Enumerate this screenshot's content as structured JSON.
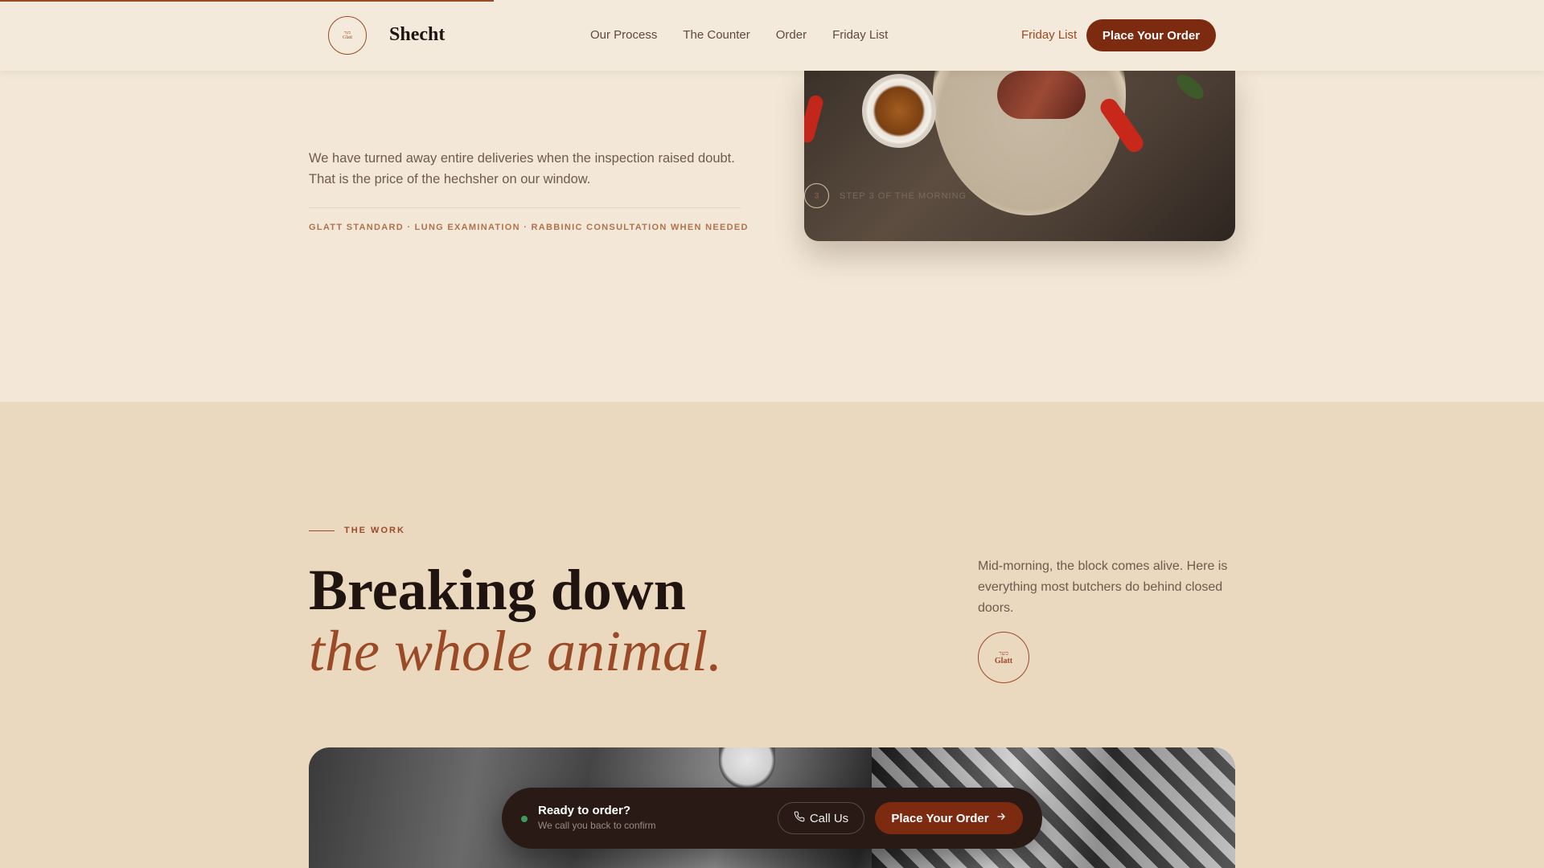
{
  "progress": {
    "fraction": 0.32,
    "color": "#9a4a26"
  },
  "header": {
    "logo": {
      "hebrew_text": "כשר",
      "latin_text": "Glatt"
    },
    "brand": "Shecht",
    "nav": [
      "Our Process",
      "The Counter",
      "Order",
      "Friday List"
    ],
    "secondary_link": "Friday List",
    "cta_label": "Place Your Order"
  },
  "process": {
    "body_lines": [
      "We have turned away entire deliveries when the inspection raised doubt.",
      "That is the price of the hechsher on our window."
    ],
    "tags": "GLATT STANDARD · LUNG EXAMINATION · RABBINIC CONSULTATION WHEN NEEDED",
    "step_number": "3",
    "step_label": "STEP 3 OF THE MORNING"
  },
  "work": {
    "eyebrow": "THE WORK",
    "headline": "Breaking down",
    "headline_accent": "the whole animal.",
    "side_text": "Mid-morning, the block comes alive. Here is everything most butchers do behind closed doors.",
    "seal": {
      "hebrew_text": "כשר",
      "latin_text": "Glatt"
    }
  },
  "order_bar": {
    "title": "Ready to order?",
    "subtitle": "We call you back to confirm",
    "call_label": "Call Us",
    "order_label": "Place Your Order",
    "status_color": "#3e9a5a"
  },
  "colors": {
    "accent": "#9a4a26",
    "cta": "#7c2a10",
    "background_light": "#f3e8d8",
    "background_tan": "#ead9bf"
  },
  "icons": {
    "phone": "phone-icon",
    "arrow": "arrow-right-icon"
  }
}
